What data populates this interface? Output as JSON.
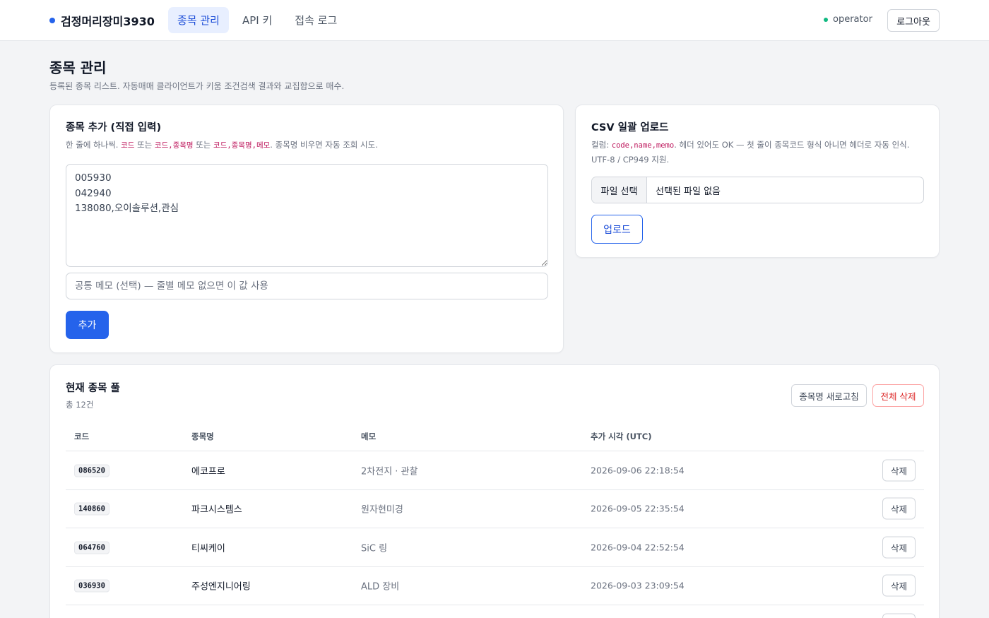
{
  "header": {
    "brand": "검정머리장미3930",
    "tabs": [
      {
        "label": "종목 관리",
        "active": true
      },
      {
        "label": "API 키",
        "active": false
      },
      {
        "label": "접속 로그",
        "active": false
      }
    ],
    "user": "operator",
    "logout_label": "로그아웃",
    "accent_color": "#2563eb",
    "status_color": "#10b981"
  },
  "page": {
    "title": "종목 관리",
    "subtitle": "등록된 종목 리스트. 자동매매 클라이언트가 키움 조건검색 결과와 교집합으로 매수."
  },
  "add_card": {
    "title": "종목 추가 (직접 입력)",
    "help_prefix": "한 줄에 하나씩.",
    "help_code1": "코드",
    "help_or1": "또는",
    "help_code2": "코드,종목명",
    "help_or2": "또는",
    "help_code3": "코드,종목명,메모",
    "help_suffix": ". 종목명 비우면 자동 조회 시도.",
    "textarea_value": "005930\n042940\n138080,오이솔루션,관심",
    "memo_placeholder": "공통 메모 (선택) — 줄별 메모 없으면 이 값 사용",
    "add_label": "추가"
  },
  "csv_card": {
    "title": "CSV 일괄 업로드",
    "help_prefix": "컬럼:",
    "help_code": "code,name,memo",
    "help_suffix": ". 헤더 있어도 OK — 첫 줄이 종목코드 형식 아니면 헤더로 자동 인식.",
    "help_line2": "UTF-8 / CP949 지원.",
    "file_button": "파일 선택",
    "file_status": "선택된 파일 없음",
    "upload_label": "업로드"
  },
  "pool": {
    "title": "현재 종목 풀",
    "count": "총 12건",
    "refresh_label": "종목명 새로고침",
    "delete_all_label": "전체 삭제",
    "columns": [
      "코드",
      "종목명",
      "메모",
      "추가 시각 (UTC)"
    ],
    "rows": [
      {
        "code": "086520",
        "name": "에코프로",
        "memo": "2차전지 · 관찰",
        "time": "2026-09-06 22:18:54",
        "action": "삭제"
      },
      {
        "code": "140860",
        "name": "파크시스템스",
        "memo": "원자현미경",
        "time": "2026-09-05 22:35:54",
        "action": "삭제"
      },
      {
        "code": "064760",
        "name": "티씨케이",
        "memo": "SiC 링",
        "time": "2026-09-04 22:52:54",
        "action": "삭제"
      },
      {
        "code": "036930",
        "name": "주성엔지니어링",
        "memo": "ALD 장비",
        "time": "2026-09-03 23:09:54",
        "action": "삭제"
      },
      {
        "code": "",
        "name": "",
        "memo": "",
        "time": "",
        "action": ""
      }
    ]
  }
}
